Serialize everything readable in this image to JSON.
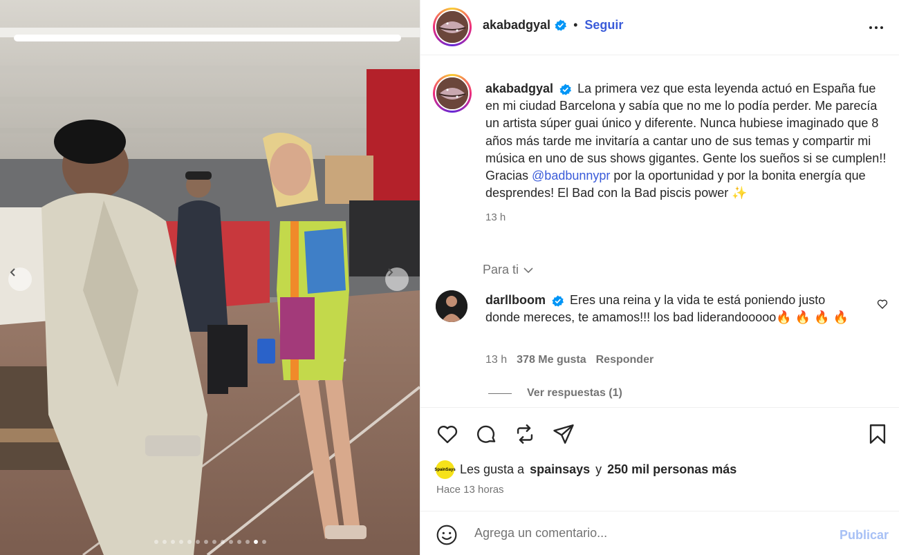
{
  "post": {
    "username": "akabadgyal",
    "separator": "•",
    "follow_label": "Seguir",
    "more_icon": "more-horizontal-icon",
    "caption_parts": {
      "before": "La primera vez que esta leyenda actuó en España fue en mi ciudad Barcelona y sabía que no me lo podía perder. Me parecía un artista súper guai único y diferente. Nunca hubiese imaginado que 8 años más tarde me invitaría a cantar uno de sus temas y compartir mi música en uno de sus shows gigantes. Gente los sueños si se cumplen!! Gracias ",
      "mention": "@badbunnypr",
      "after": " por la oportunidad y por la bonita energía que desprendes! El Bad con la Bad piscis power ✨"
    },
    "caption_time": "13 h"
  },
  "section_label": "Para ti",
  "comment": {
    "username": "darllboom",
    "text": "Eres una reina y la vida te está poniendo justo donde mereces, te amamos!!! los bad liderandooooo🔥 🔥 🔥 🔥",
    "time": "13 h",
    "likes": "378 Me gusta",
    "reply_label": "Responder",
    "view_replies": "Ver respuestas (1)"
  },
  "likes": {
    "prefix": "Les gusta a",
    "user": "spainsays",
    "conjunction": "y",
    "others": "250 mil personas más",
    "avatar_text": "SpainSays"
  },
  "posted_ago": "Hace 13 horas",
  "add_comment": {
    "placeholder": "Agrega un comentario...",
    "publish_label": "Publicar"
  },
  "carousel": {
    "total": 14,
    "active": 12
  },
  "colors": {
    "link": "#3a5bd9",
    "muted": "#737373",
    "verified": "#0095f6",
    "publish_disabled": "#a7c0f5"
  }
}
